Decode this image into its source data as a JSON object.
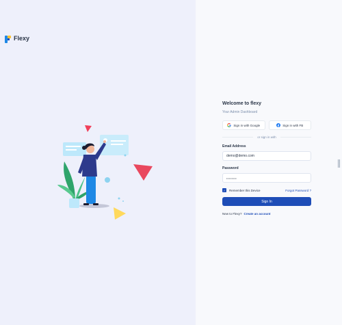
{
  "brand": {
    "name": "Flexy"
  },
  "login": {
    "title": "Welcome to flexy",
    "subtitle": "Your Admin Dashboard",
    "google_label": "Sign in with Google",
    "fb_label": "Sign in with FB",
    "divider_text": "or sign in with",
    "email_label": "Email Address",
    "email_value": "demo@demo.com",
    "password_label": "Password",
    "password_value": "••••••••",
    "remember_label": "Remember this Device",
    "remember_checked": true,
    "forgot_label": "Forgot Password ?",
    "signin_label": "Sign In",
    "new_prompt": "New to Flexy?",
    "create_label": "Create an account"
  },
  "colors": {
    "primary": "#1e4db7",
    "left_bg": "#eef0fb",
    "right_bg": "#f8f9fc",
    "text_dark": "#2a3547",
    "text_muted": "#7c8fac"
  },
  "icons": [
    "flexy-logo-icon",
    "google-icon",
    "facebook-icon",
    "check-icon",
    "resize-handle-icon"
  ]
}
